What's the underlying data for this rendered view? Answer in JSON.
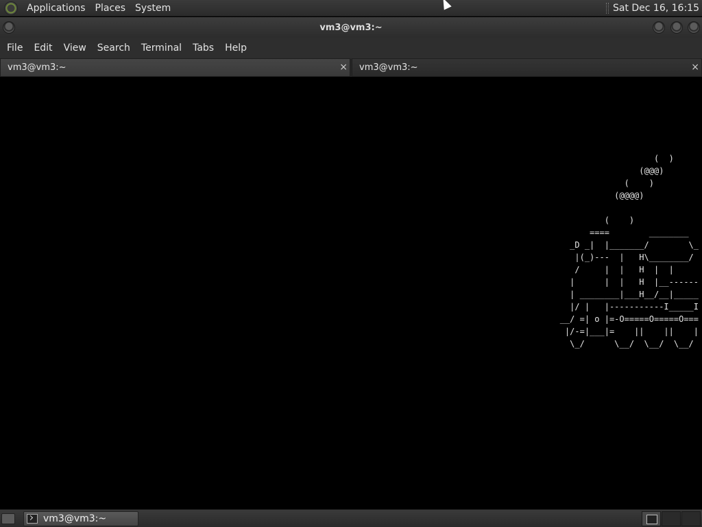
{
  "top_panel": {
    "menus": [
      "Applications",
      "Places",
      "System"
    ],
    "clock": "Sat Dec 16, 16:15"
  },
  "window": {
    "title": "vm3@vm3:~"
  },
  "menubar": {
    "items": [
      "File",
      "Edit",
      "View",
      "Search",
      "Terminal",
      "Tabs",
      "Help"
    ]
  },
  "tabs": [
    {
      "label": "vm3@vm3:~",
      "close": "×"
    },
    {
      "label": "vm3@vm3:~",
      "close": "×"
    }
  ],
  "terminal": {
    "art": "                     (  )\n                  (@@@)\n               (    )\n             (@@@@)\n\n           (    )\n        ====        ________\n    _D _|  |_______/        \\_\n     |(_)---  |   H\\________/\n     /     |  |   H  |  |\n    |      |  |   H  |__------\n    | ________|___H__/__|_____\n    |/ |   |-----------I_____I\n  __/ =| o |=-O=====O=====O===\n   |/-=|___|=    ||    ||    |\n    \\_/      \\__/  \\__/  \\__/"
  },
  "taskbar": {
    "window_label": "vm3@vm3:~"
  }
}
